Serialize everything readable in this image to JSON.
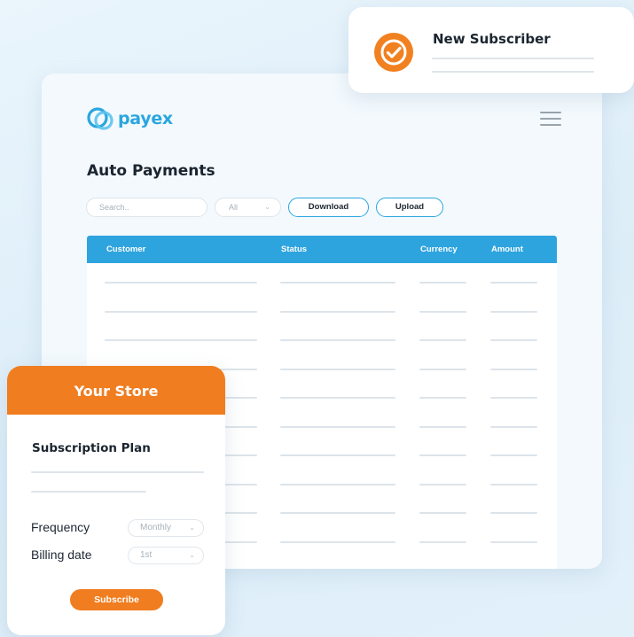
{
  "dashboard": {
    "brand": {
      "name": "payex",
      "icon": "payex-logo-icon",
      "color": "#2aa6df"
    },
    "menu_icon": "hamburger-menu-icon",
    "title": "Auto Payments",
    "search": {
      "placeholder": "Search.."
    },
    "filter": {
      "value": "All",
      "icon": "chevron-down-icon"
    },
    "buttons": {
      "download": "Download",
      "upload": "Upload"
    },
    "table": {
      "header_color": "#2ea4df",
      "columns": [
        "Customer",
        "Status",
        "Currency",
        "Amount"
      ],
      "placeholder_rows": 10
    }
  },
  "notification": {
    "icon": "check-circle-icon",
    "accent": "#f18120",
    "title": "New Subscriber"
  },
  "store": {
    "header": "Your Store",
    "accent": "#f07d1f",
    "plan_title": "Subscription Plan",
    "fields": [
      {
        "label": "Frequency",
        "value": "Monthly"
      },
      {
        "label": "Billing date",
        "value": "1st"
      }
    ],
    "subscribe_label": "Subscribe"
  }
}
